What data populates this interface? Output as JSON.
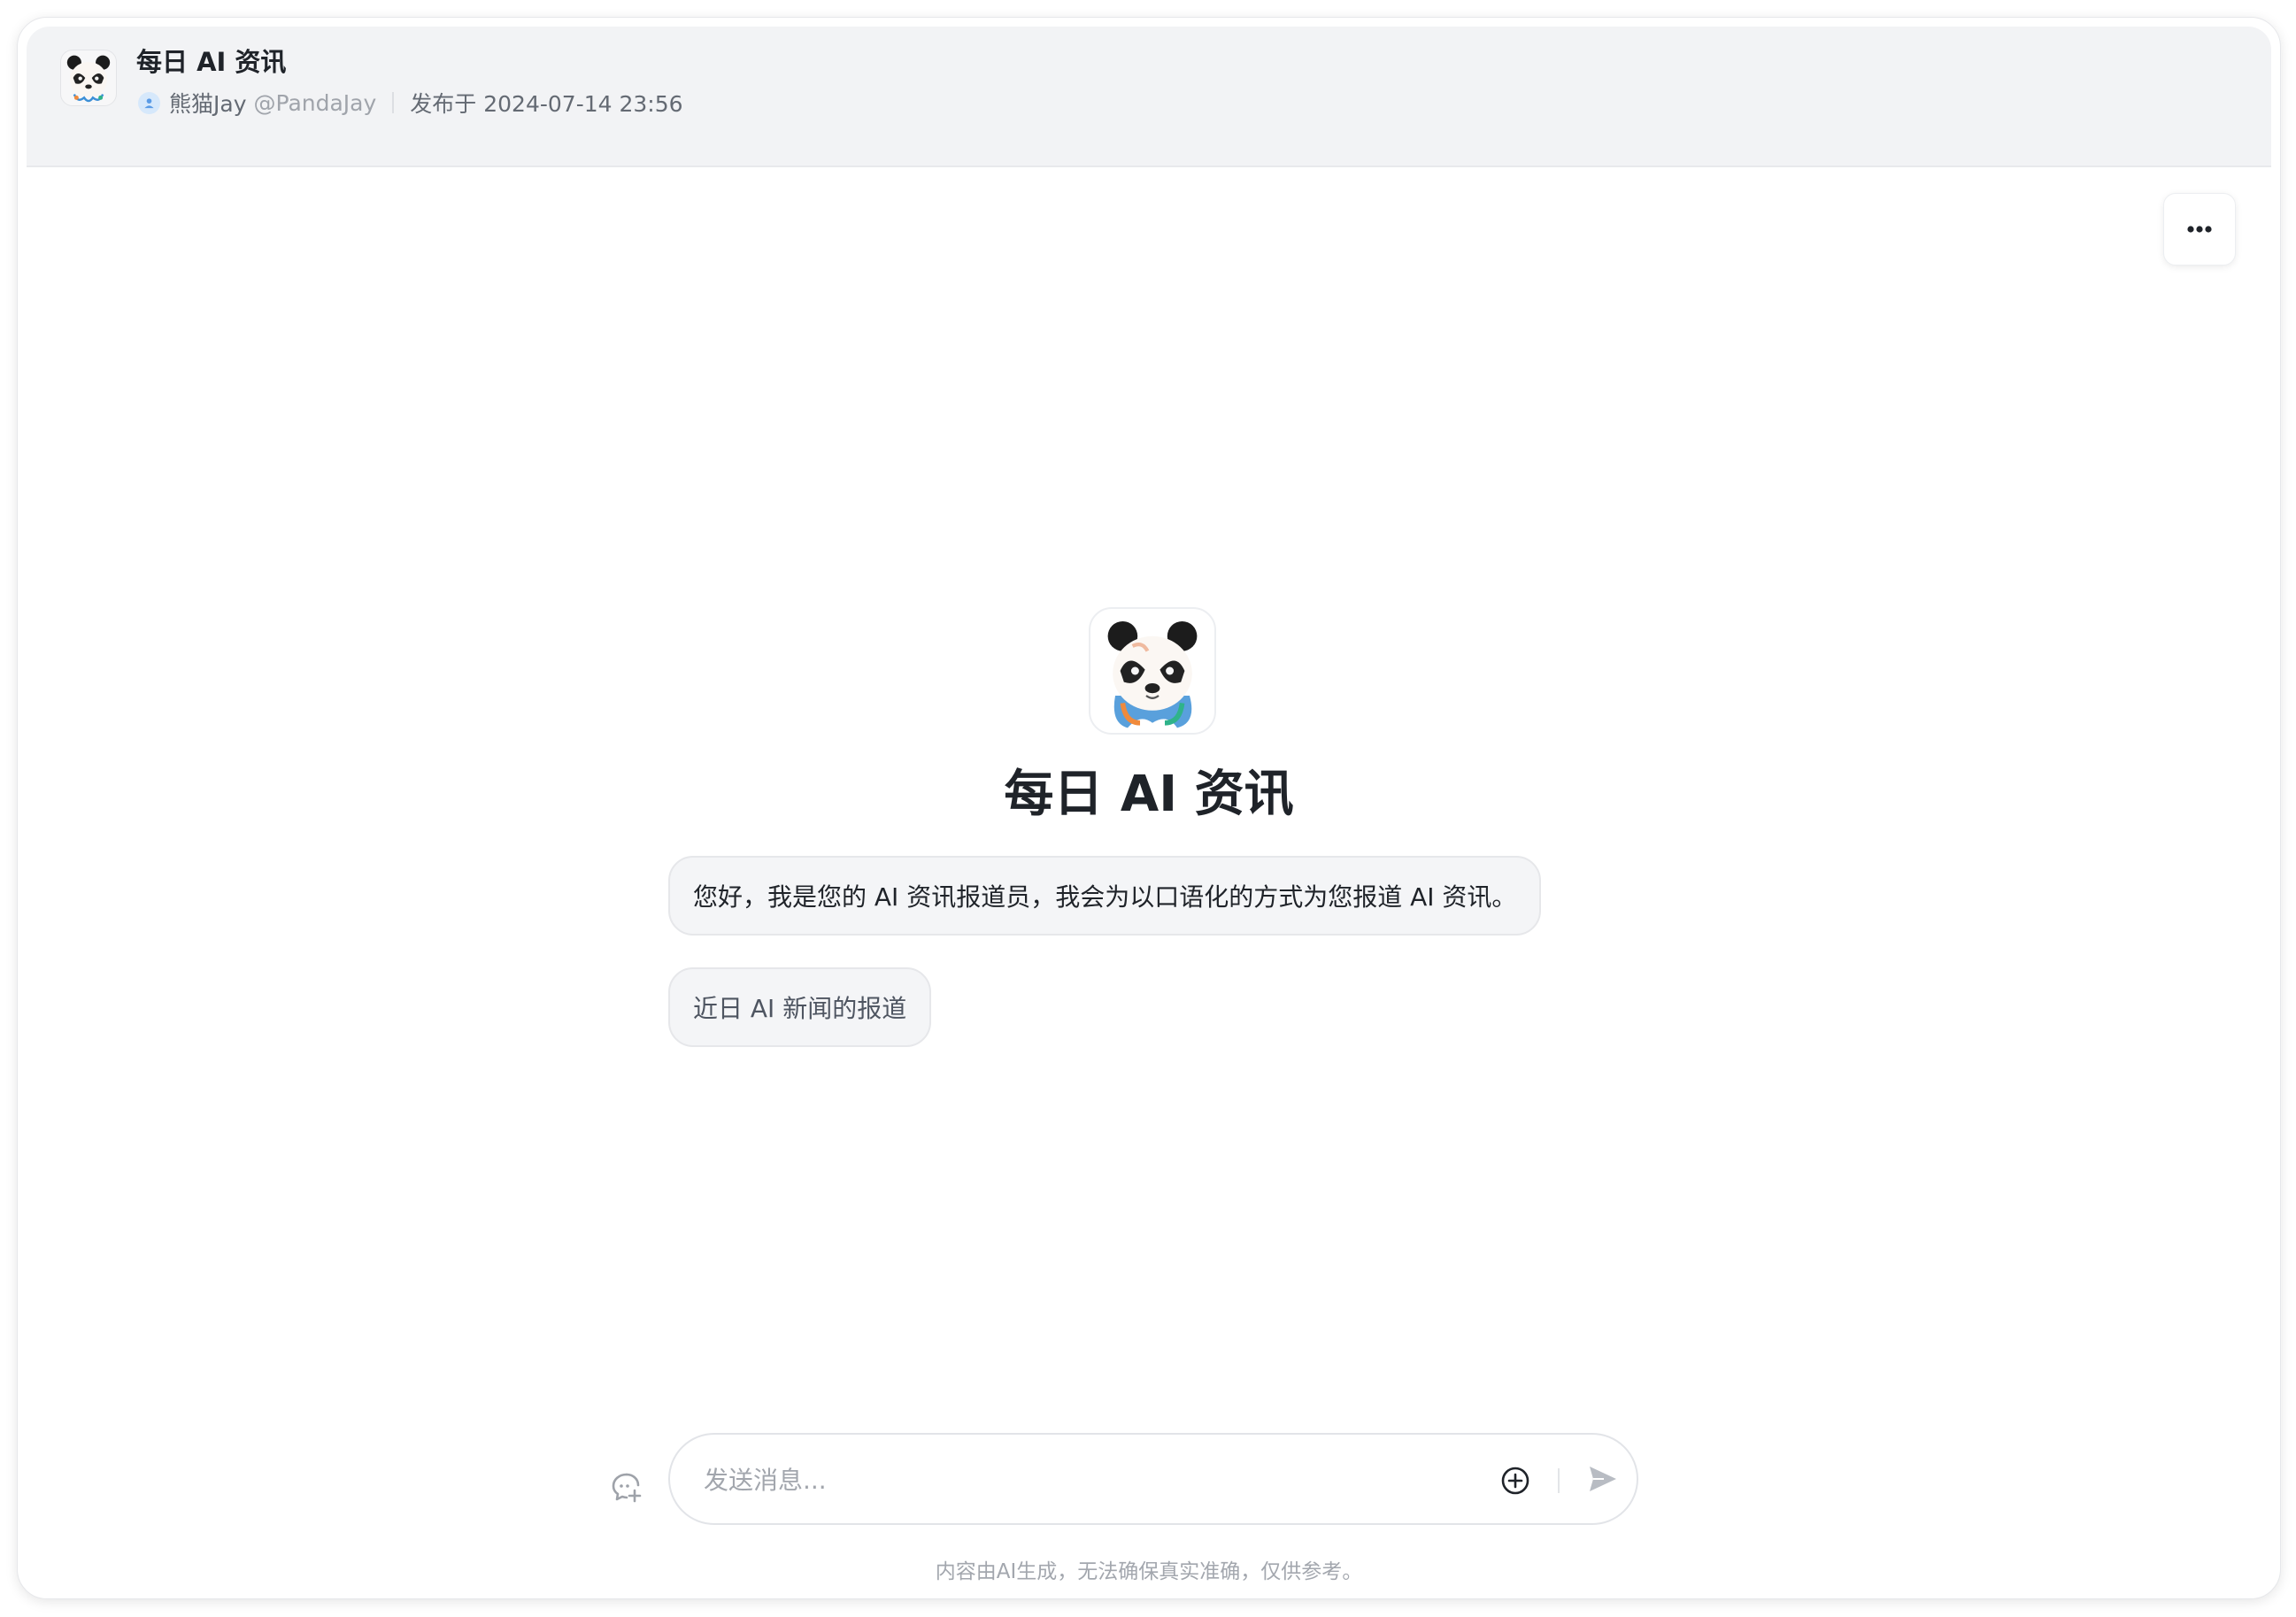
{
  "header": {
    "title": "每日 AI 资讯",
    "author_name": "熊猫Jay",
    "author_handle": "@PandaJay",
    "published": "发布于 2024-07-14 23:56"
  },
  "bot": {
    "name": "每日 AI 资讯",
    "intro": "您好，我是您的 AI 资讯报道员，我会为以口语化的方式为您报道 AI 资讯。",
    "suggestion": "近日 AI 新闻的报道"
  },
  "composer": {
    "placeholder": "发送消息..."
  },
  "footer": {
    "disclaimer": "内容由AI生成，无法确保真实准确，仅供参考。"
  },
  "icons": {
    "more": "more-icon",
    "user": "user-icon",
    "new_chat": "new-chat-icon",
    "attach": "plus-circle-icon",
    "send": "send-icon"
  },
  "colors": {
    "header_bg": "#f2f3f5",
    "bubble_bg": "#f4f5f7",
    "text_primary": "#1f2329",
    "text_muted": "#a3a7ae"
  }
}
